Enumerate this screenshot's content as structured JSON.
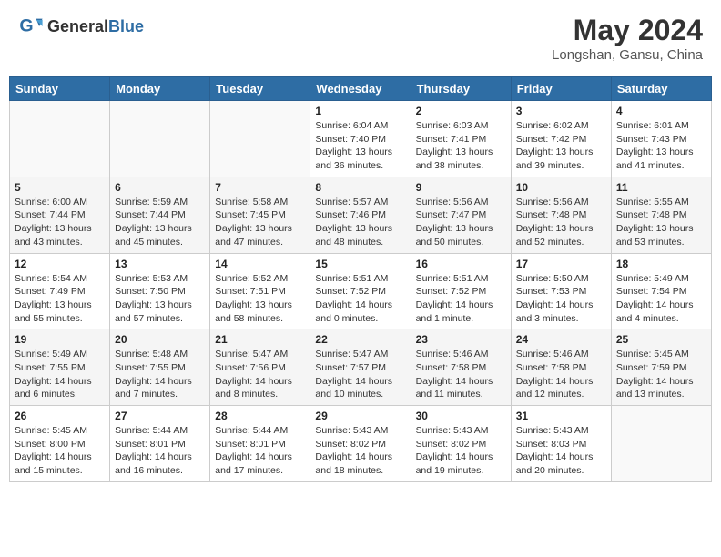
{
  "header": {
    "logo_general": "General",
    "logo_blue": "Blue",
    "month_title": "May 2024",
    "location": "Longshan, Gansu, China"
  },
  "days_of_week": [
    "Sunday",
    "Monday",
    "Tuesday",
    "Wednesday",
    "Thursday",
    "Friday",
    "Saturday"
  ],
  "weeks": [
    [
      {
        "day": "",
        "info": ""
      },
      {
        "day": "",
        "info": ""
      },
      {
        "day": "",
        "info": ""
      },
      {
        "day": "1",
        "info": "Sunrise: 6:04 AM\nSunset: 7:40 PM\nDaylight: 13 hours\nand 36 minutes."
      },
      {
        "day": "2",
        "info": "Sunrise: 6:03 AM\nSunset: 7:41 PM\nDaylight: 13 hours\nand 38 minutes."
      },
      {
        "day": "3",
        "info": "Sunrise: 6:02 AM\nSunset: 7:42 PM\nDaylight: 13 hours\nand 39 minutes."
      },
      {
        "day": "4",
        "info": "Sunrise: 6:01 AM\nSunset: 7:43 PM\nDaylight: 13 hours\nand 41 minutes."
      }
    ],
    [
      {
        "day": "5",
        "info": "Sunrise: 6:00 AM\nSunset: 7:44 PM\nDaylight: 13 hours\nand 43 minutes."
      },
      {
        "day": "6",
        "info": "Sunrise: 5:59 AM\nSunset: 7:44 PM\nDaylight: 13 hours\nand 45 minutes."
      },
      {
        "day": "7",
        "info": "Sunrise: 5:58 AM\nSunset: 7:45 PM\nDaylight: 13 hours\nand 47 minutes."
      },
      {
        "day": "8",
        "info": "Sunrise: 5:57 AM\nSunset: 7:46 PM\nDaylight: 13 hours\nand 48 minutes."
      },
      {
        "day": "9",
        "info": "Sunrise: 5:56 AM\nSunset: 7:47 PM\nDaylight: 13 hours\nand 50 minutes."
      },
      {
        "day": "10",
        "info": "Sunrise: 5:56 AM\nSunset: 7:48 PM\nDaylight: 13 hours\nand 52 minutes."
      },
      {
        "day": "11",
        "info": "Sunrise: 5:55 AM\nSunset: 7:48 PM\nDaylight: 13 hours\nand 53 minutes."
      }
    ],
    [
      {
        "day": "12",
        "info": "Sunrise: 5:54 AM\nSunset: 7:49 PM\nDaylight: 13 hours\nand 55 minutes."
      },
      {
        "day": "13",
        "info": "Sunrise: 5:53 AM\nSunset: 7:50 PM\nDaylight: 13 hours\nand 57 minutes."
      },
      {
        "day": "14",
        "info": "Sunrise: 5:52 AM\nSunset: 7:51 PM\nDaylight: 13 hours\nand 58 minutes."
      },
      {
        "day": "15",
        "info": "Sunrise: 5:51 AM\nSunset: 7:52 PM\nDaylight: 14 hours\nand 0 minutes."
      },
      {
        "day": "16",
        "info": "Sunrise: 5:51 AM\nSunset: 7:52 PM\nDaylight: 14 hours\nand 1 minute."
      },
      {
        "day": "17",
        "info": "Sunrise: 5:50 AM\nSunset: 7:53 PM\nDaylight: 14 hours\nand 3 minutes."
      },
      {
        "day": "18",
        "info": "Sunrise: 5:49 AM\nSunset: 7:54 PM\nDaylight: 14 hours\nand 4 minutes."
      }
    ],
    [
      {
        "day": "19",
        "info": "Sunrise: 5:49 AM\nSunset: 7:55 PM\nDaylight: 14 hours\nand 6 minutes."
      },
      {
        "day": "20",
        "info": "Sunrise: 5:48 AM\nSunset: 7:55 PM\nDaylight: 14 hours\nand 7 minutes."
      },
      {
        "day": "21",
        "info": "Sunrise: 5:47 AM\nSunset: 7:56 PM\nDaylight: 14 hours\nand 8 minutes."
      },
      {
        "day": "22",
        "info": "Sunrise: 5:47 AM\nSunset: 7:57 PM\nDaylight: 14 hours\nand 10 minutes."
      },
      {
        "day": "23",
        "info": "Sunrise: 5:46 AM\nSunset: 7:58 PM\nDaylight: 14 hours\nand 11 minutes."
      },
      {
        "day": "24",
        "info": "Sunrise: 5:46 AM\nSunset: 7:58 PM\nDaylight: 14 hours\nand 12 minutes."
      },
      {
        "day": "25",
        "info": "Sunrise: 5:45 AM\nSunset: 7:59 PM\nDaylight: 14 hours\nand 13 minutes."
      }
    ],
    [
      {
        "day": "26",
        "info": "Sunrise: 5:45 AM\nSunset: 8:00 PM\nDaylight: 14 hours\nand 15 minutes."
      },
      {
        "day": "27",
        "info": "Sunrise: 5:44 AM\nSunset: 8:01 PM\nDaylight: 14 hours\nand 16 minutes."
      },
      {
        "day": "28",
        "info": "Sunrise: 5:44 AM\nSunset: 8:01 PM\nDaylight: 14 hours\nand 17 minutes."
      },
      {
        "day": "29",
        "info": "Sunrise: 5:43 AM\nSunset: 8:02 PM\nDaylight: 14 hours\nand 18 minutes."
      },
      {
        "day": "30",
        "info": "Sunrise: 5:43 AM\nSunset: 8:02 PM\nDaylight: 14 hours\nand 19 minutes."
      },
      {
        "day": "31",
        "info": "Sunrise: 5:43 AM\nSunset: 8:03 PM\nDaylight: 14 hours\nand 20 minutes."
      },
      {
        "day": "",
        "info": ""
      }
    ]
  ]
}
